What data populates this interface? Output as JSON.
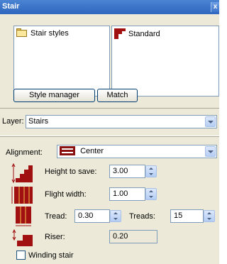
{
  "window": {
    "title": "Stair",
    "close_glyph": "x"
  },
  "styles": {
    "tree_item": "Stair styles",
    "list_item": "Standard",
    "style_manager_label": "Style manager",
    "match_label": "Match"
  },
  "layer": {
    "label": "Layer:",
    "value": "Stairs"
  },
  "alignment": {
    "label": "Alignment:",
    "value": "Center"
  },
  "params": {
    "height_label": "Height to save:",
    "height_value": "3.00",
    "flight_width_label": "Flight width:",
    "flight_width_value": "1.00",
    "tread_label": "Tread:",
    "tread_value": "0.30",
    "treads_label": "Treads:",
    "treads_value": "15",
    "riser_label": "Riser:",
    "riser_value": "0.20"
  },
  "winding": {
    "label": "Winding stair",
    "checked": false
  },
  "colors": {
    "accent": "#a01010",
    "titlebar": "#3b73c9",
    "panel": "#ece9d8"
  }
}
